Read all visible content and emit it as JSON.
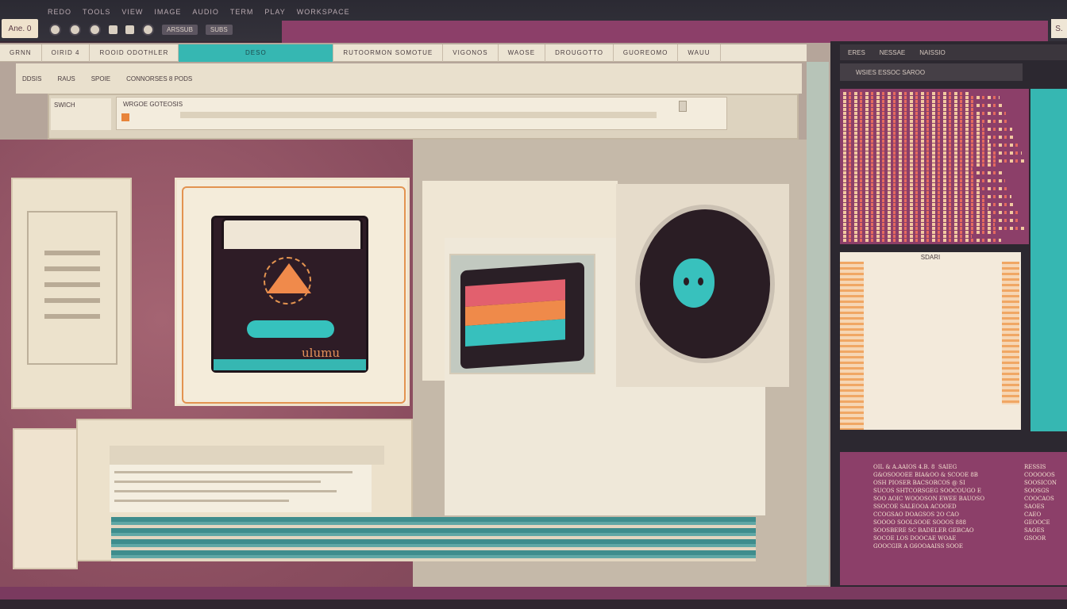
{
  "app": {
    "name": "Ane. 0",
    "corner": "S."
  },
  "top_strip": [
    "REDO",
    "TOOLS",
    "VIEW",
    "IMAGE",
    "AUDIO",
    "TERM",
    "PLAY",
    "WORKSPACE"
  ],
  "toolbar": {
    "button1": "ARSSUB",
    "button2": "SUBS"
  },
  "tabs": [
    {
      "label": "GRNN"
    },
    {
      "label": "OIRID 4"
    },
    {
      "label": "ROOID ODOTHLER"
    },
    {
      "label": "DESO",
      "active": true
    },
    {
      "label": "RUTOORMON SOMOTUE"
    },
    {
      "label": "VIGONOS"
    },
    {
      "label": "WAOSE"
    },
    {
      "label": "DROUGOTTO"
    },
    {
      "label": "GUOREOMO"
    },
    {
      "label": "WAUU"
    }
  ],
  "breadcrumbs": [
    "DDSIS",
    "RAUS",
    "SPOIE",
    "CONNORSES 8 PODS"
  ],
  "panel": {
    "label": "SWICH",
    "url": "WRGOE GOTEOSIS"
  },
  "logo_text": "ulumu",
  "right": {
    "title": [
      "ERES",
      "NESSAE",
      "NAISSIO"
    ],
    "subtitle": "WSIES ESSOC SAROO",
    "doc_title": "SDARI",
    "text_block": "OIL & A.AAIOS 4.B. 8  SAIEG\nG&OSOOOEE BIA&OO & SCOOE 8B\nOSH PIOSER BACSORCOS @ SI\nSUCOS SHTCORSGEG SOOCOUGO E\nSOO AOIC WOOOSON EWEE BAUOSO\nSSOCOE SALEOOA ACOOED\nCCOGSAO DOAGSOS 2O CAO\nSOOOO SOOLSOOE SOOOS 888\nSOOSBERE SC BADELER GEBCAO\nSOCOE LOS DOOCAE WOAE\nGOOCGIR A G6OOAAISS SOOE",
    "text_block2": "RESSIS\nCOOOOOS\nSOOSICON\nSOOSGS\nCOOCAOS\nSAOES\nCAEO\nGEOOCE\nSAOES\nGSOOR"
  },
  "colors": {
    "accent_teal": "#36b7b2",
    "accent_magenta": "#8c3f69",
    "accent_orange": "#f08a4b",
    "paper": "#efe6d6"
  }
}
